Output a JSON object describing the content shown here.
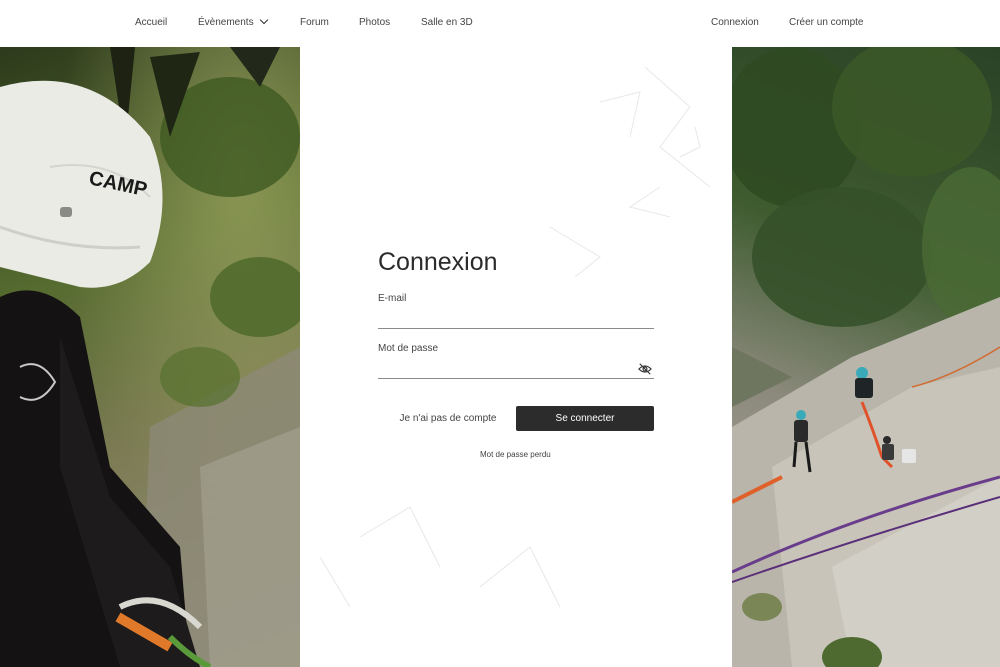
{
  "nav": {
    "home": "Accueil",
    "events": "Évènements",
    "forum": "Forum",
    "photos": "Photos",
    "room3d": "Salle en 3D",
    "login": "Connexion",
    "signup": "Créer un compte"
  },
  "helmet_brand": "CAMP",
  "form": {
    "title": "Connexion",
    "email_label": "E-mail",
    "email_value": "",
    "password_label": "Mot de passe",
    "password_value": "",
    "no_account": "Je n'ai pas de compte",
    "submit": "Se connecter",
    "lost_password": "Mot de passe perdu"
  },
  "colors": {
    "primary_button": "#2c2c2c",
    "text": "#333333"
  },
  "icons": {
    "events_dropdown": "chevron-down-icon",
    "password_toggle": "eye-off-icon"
  }
}
